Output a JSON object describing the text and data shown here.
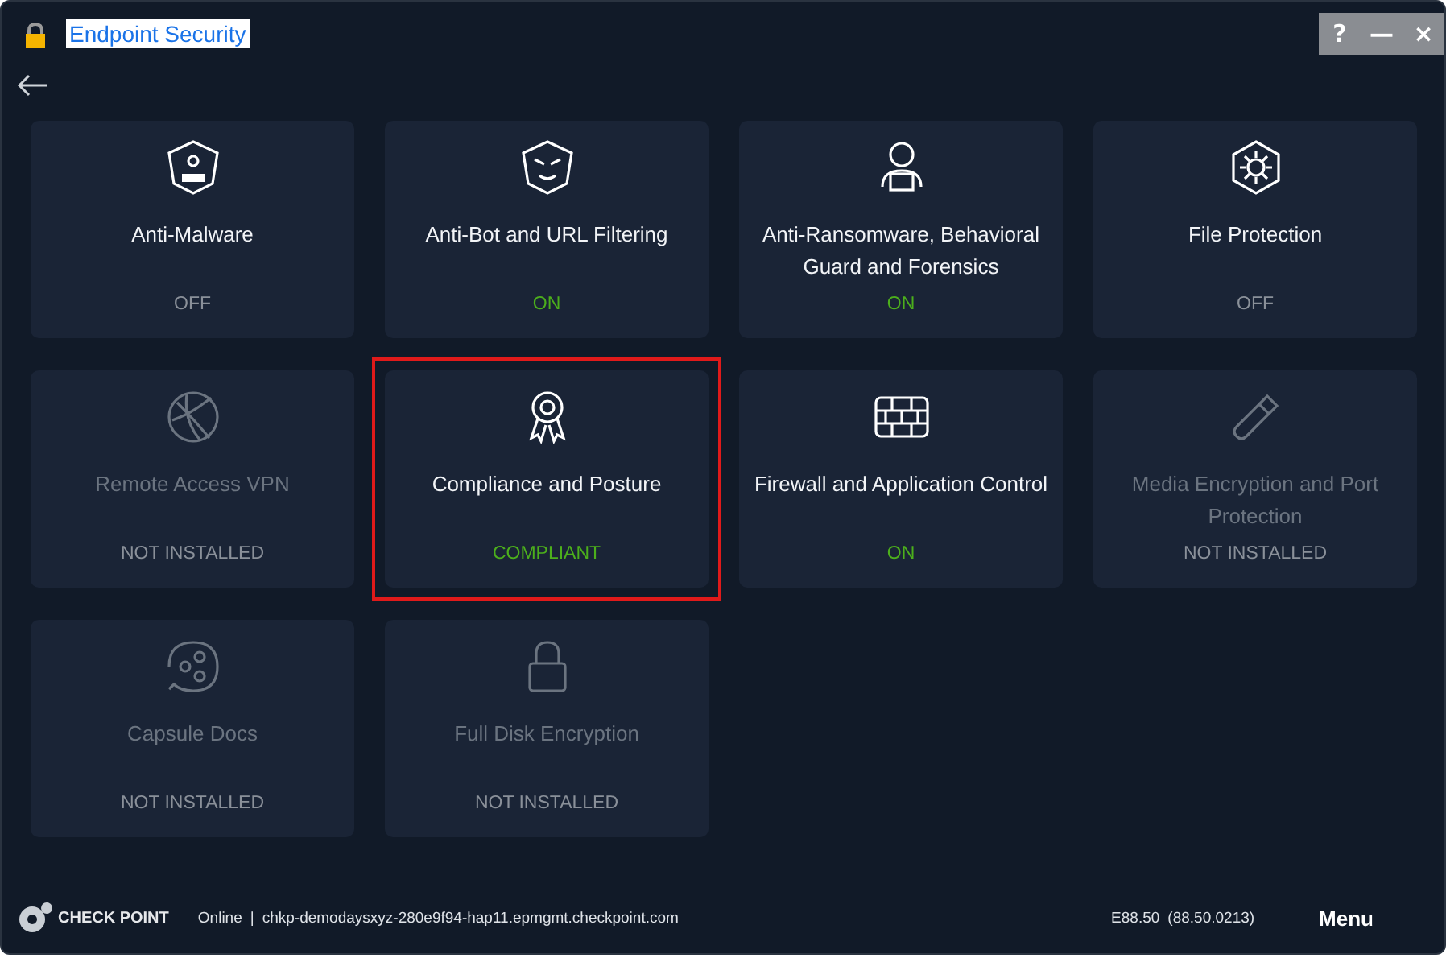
{
  "window": {
    "title": "Endpoint Security",
    "controls": [
      "?",
      "—",
      "×"
    ]
  },
  "modules": [
    {
      "title": "Anti-Malware",
      "status": "OFF",
      "color": "#8a9099",
      "installed": true,
      "selected": false
    },
    {
      "title": "Anti-Bot and URL Filtering",
      "status": "ON",
      "color": "#4caf1c",
      "installed": true,
      "selected": false
    },
    {
      "title": "Anti-Ransomware, Behavioral Guard and Forensics",
      "status": "ON",
      "color": "#4caf1c",
      "installed": true,
      "selected": false
    },
    {
      "title": "File Protection",
      "status": "OFF",
      "color": "#8a9099",
      "installed": true,
      "selected": false
    },
    {
      "title": "Remote Access VPN",
      "status": "NOT INSTALLED",
      "color": "#8a9099",
      "installed": false,
      "selected": false
    },
    {
      "title": "Compliance and Posture",
      "status": "COMPLIANT",
      "color": "#4caf1c",
      "installed": true,
      "selected": true
    },
    {
      "title": "Firewall and Application Control",
      "status": "ON",
      "color": "#4caf1c",
      "installed": true,
      "selected": false
    },
    {
      "title": "Media Encryption and Port Protection",
      "status": "NOT INSTALLED",
      "color": "#8a9099",
      "installed": false,
      "selected": false
    },
    {
      "title": "Capsule Docs",
      "status": "NOT INSTALLED",
      "color": "#8a9099",
      "installed": false,
      "selected": false
    },
    {
      "title": "Full Disk Encryption",
      "status": "NOT INSTALLED",
      "color": "#8a9099",
      "installed": false,
      "selected": false
    }
  ],
  "status_bar": {
    "brand": "CHECK POINT",
    "connection": "Online",
    "separator": "|",
    "server": "chkp-demodaysxyz-280e9f94-hap11.epmgmt.checkpoint.com",
    "version": "E88.50",
    "build": "(88.50.0213)",
    "menu": "Menu"
  }
}
